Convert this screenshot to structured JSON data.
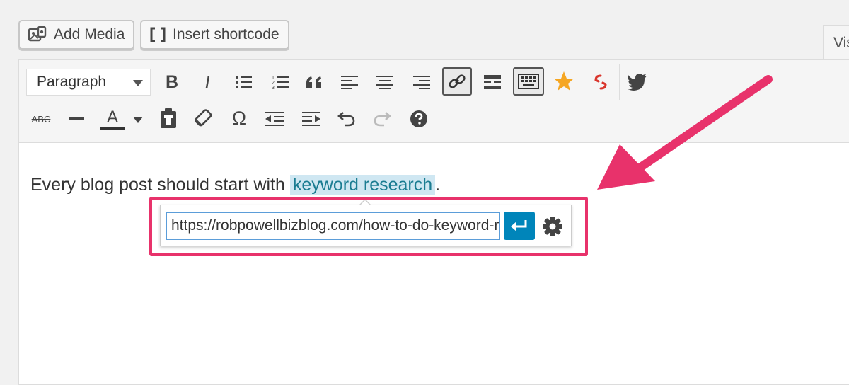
{
  "topbar": {
    "add_media_label": "Add Media",
    "insert_shortcode_label": "Insert shortcode",
    "visual_tab_label": "Vis"
  },
  "toolbar": {
    "format_select_value": "Paragraph",
    "icons_row1": [
      "bold-icon",
      "italic-icon",
      "bullet-list-icon",
      "numbered-list-icon",
      "blockquote-icon",
      "align-left-icon",
      "align-center-icon",
      "align-right-icon",
      "link-icon",
      "read-more-icon",
      "toolbar-toggle-icon",
      "star-icon",
      "shortlink-icon",
      "twitter-icon"
    ],
    "icons_row2": [
      "strikethrough-icon",
      "horizontal-line-icon",
      "text-color-icon",
      "paste-text-icon",
      "clear-formatting-icon",
      "special-character-icon",
      "outdent-icon",
      "indent-icon",
      "undo-icon",
      "redo-icon",
      "help-icon"
    ],
    "strikethrough_text": "ABC",
    "bold_text": "B",
    "italic_text": "I",
    "text_color_text": "A",
    "omega_text": "Ω"
  },
  "content": {
    "text_before": "Every blog post should start with ",
    "link_text": "keyword research",
    "text_after": "."
  },
  "link_popup": {
    "url_value": "https://robpowellbizblog.com/how-to-do-keyword-research"
  },
  "colors": {
    "highlight": "#e8326b",
    "apply_button": "#0085ba",
    "link_bg": "#cfe7f2",
    "link_text": "#1a7c91",
    "star": "#f5a623",
    "shortlink": "#d9342b",
    "twitter": "#444444"
  }
}
